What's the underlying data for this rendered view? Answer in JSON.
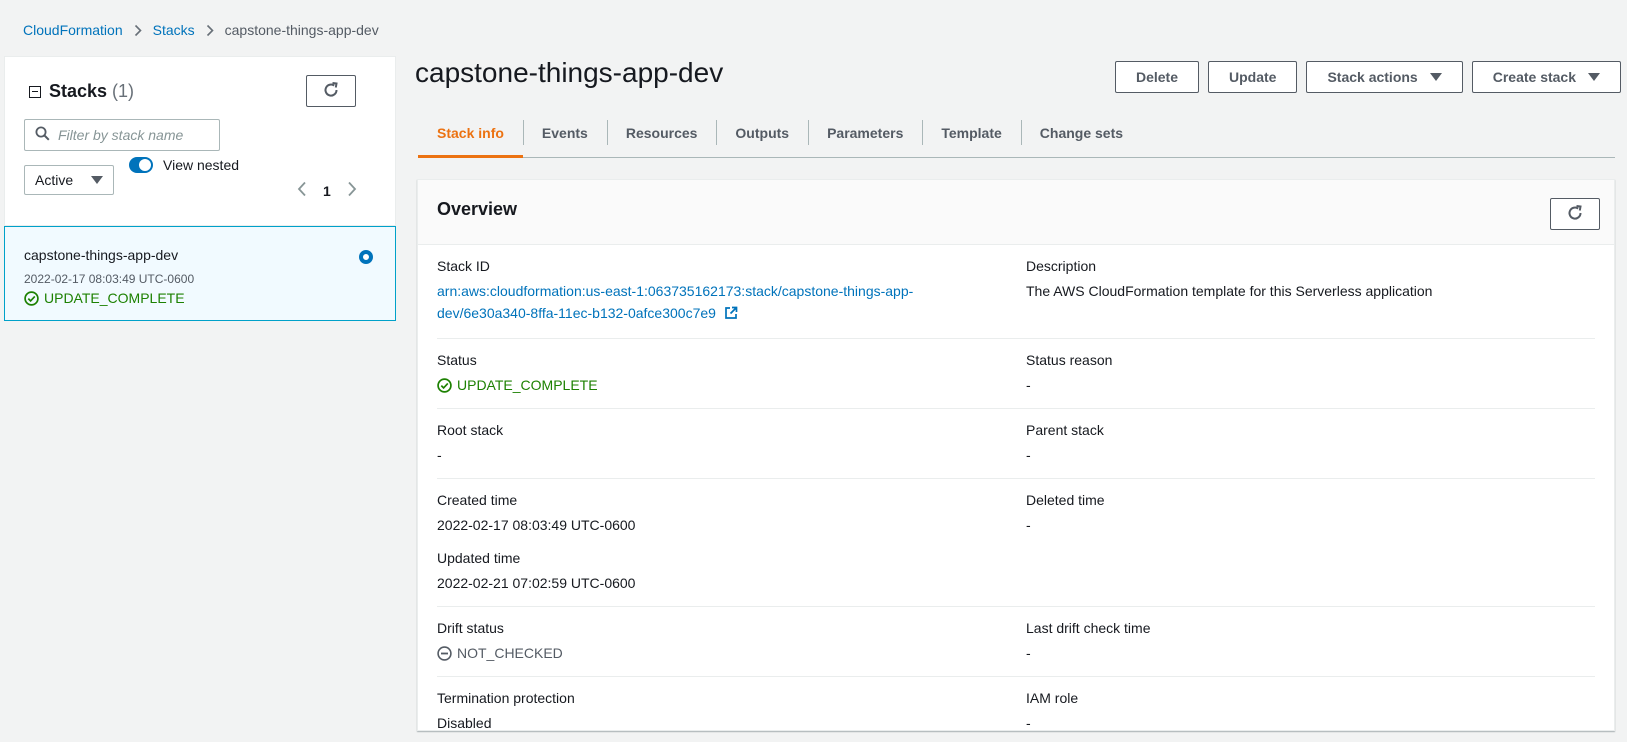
{
  "breadcrumb": {
    "items": [
      "CloudFormation",
      "Stacks"
    ],
    "current": "capstone-things-app-dev"
  },
  "left_panel": {
    "title": "Stacks",
    "count": "(1)",
    "filter_placeholder": "Filter by stack name",
    "status_filter": "Active",
    "view_nested_label": "View nested",
    "view_nested_on": true,
    "page": "1",
    "stack": {
      "name": "capstone-things-app-dev",
      "time": "2022-02-17 08:03:49 UTC-0600",
      "status": "UPDATE_COMPLETE",
      "selected": true
    }
  },
  "header": {
    "title": "capstone-things-app-dev",
    "buttons": {
      "delete": "Delete",
      "update": "Update",
      "stack_actions": "Stack actions",
      "create_stack": "Create stack"
    }
  },
  "tabs": [
    "Stack info",
    "Events",
    "Resources",
    "Outputs",
    "Parameters",
    "Template",
    "Change sets"
  ],
  "active_tab": "Stack info",
  "overview": {
    "title": "Overview",
    "stack_id_label": "Stack ID",
    "stack_id_line1": "arn:aws:cloudformation:us-east-1:063735162173:stack/capstone-things-app-",
    "stack_id_line2": "dev/6e30a340-8ffa-11ec-b132-0afce300c7e9",
    "description_label": "Description",
    "description": "The AWS CloudFormation template for this Serverless application",
    "status_label": "Status",
    "status": "UPDATE_COMPLETE",
    "status_reason_label": "Status reason",
    "status_reason": "-",
    "root_stack_label": "Root stack",
    "root_stack": "-",
    "parent_stack_label": "Parent stack",
    "parent_stack": "-",
    "created_time_label": "Created time",
    "created_time": "2022-02-17 08:03:49 UTC-0600",
    "deleted_time_label": "Deleted time",
    "deleted_time": "-",
    "updated_time_label": "Updated time",
    "updated_time": "2022-02-21 07:02:59 UTC-0600",
    "drift_status_label": "Drift status",
    "drift_status": "NOT_CHECKED",
    "last_drift_label": "Last drift check time",
    "last_drift": "-",
    "termination_label": "Termination protection",
    "termination": "Disabled",
    "iam_role_label": "IAM role",
    "iam_role": "-"
  },
  "colors": {
    "link": "#0073bb",
    "success": "#1d8102",
    "active_tab": "#ec7211",
    "selected_border": "#00a1c9"
  }
}
